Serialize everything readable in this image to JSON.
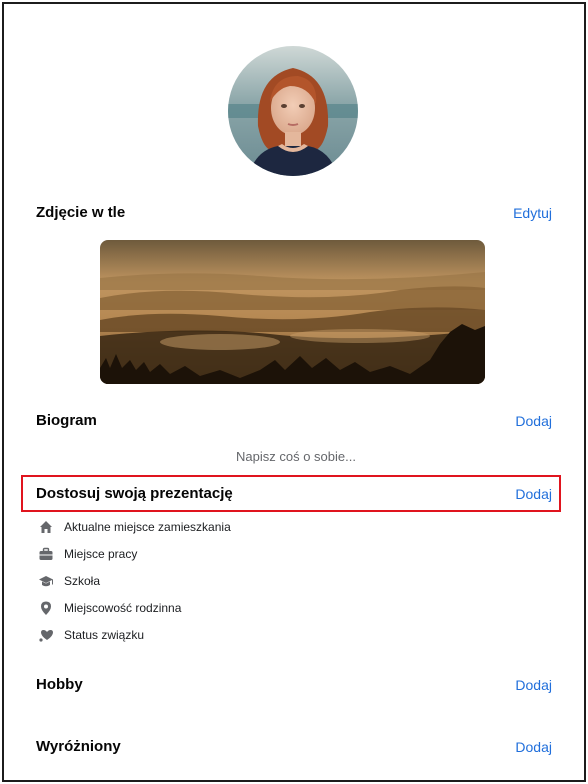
{
  "profile": {
    "avatar_alt": "Zdjęcie profilowe"
  },
  "cover_section": {
    "title": "Zdjęcie w tle",
    "action": "Edytuj"
  },
  "bio_section": {
    "title": "Biogram",
    "action": "Dodaj",
    "placeholder": "Napisz coś o sobie..."
  },
  "intro_section": {
    "title": "Dostosuj swoją prezentację",
    "action": "Dodaj",
    "items": [
      {
        "label": "Aktualne miejsce zamieszkania",
        "icon": "home-icon"
      },
      {
        "label": "Miejsce pracy",
        "icon": "briefcase-icon"
      },
      {
        "label": "Szkoła",
        "icon": "graduation-cap-icon"
      },
      {
        "label": "Miejscowość rodzinna",
        "icon": "location-pin-icon"
      },
      {
        "label": "Status związku",
        "icon": "heart-icon"
      }
    ]
  },
  "hobby_section": {
    "title": "Hobby",
    "action": "Dodaj"
  },
  "featured_section": {
    "title": "Wyróżniony",
    "action": "Dodaj"
  },
  "colors": {
    "link": "#216fdb",
    "highlight": "#e0141e",
    "icon": "#65676b"
  }
}
